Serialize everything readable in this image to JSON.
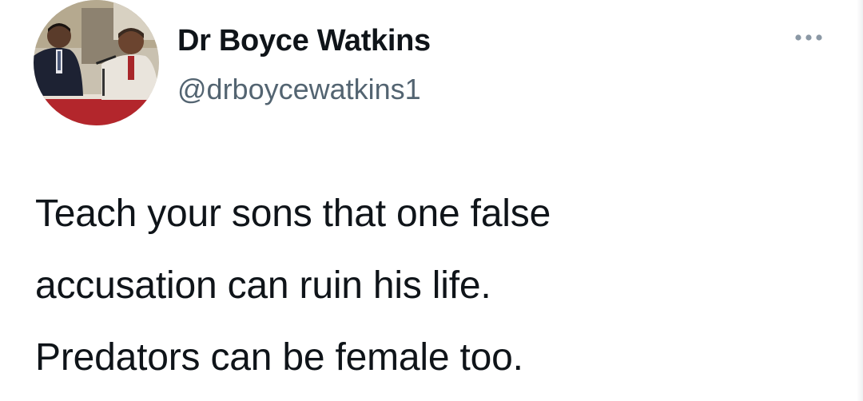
{
  "tweet": {
    "author": {
      "display_name": "Dr Boyce Watkins",
      "handle": "@drboycewatkins1"
    },
    "avatar_icon": "profile-photo",
    "more_icon": "more-horizontal-icon",
    "text_lines": [
      "Teach your sons that one false",
      "accusation can ruin his life.",
      "Predators can be female too."
    ]
  },
  "colors": {
    "text_primary": "#0f1419",
    "text_secondary": "#536471",
    "background": "#ffffff"
  }
}
